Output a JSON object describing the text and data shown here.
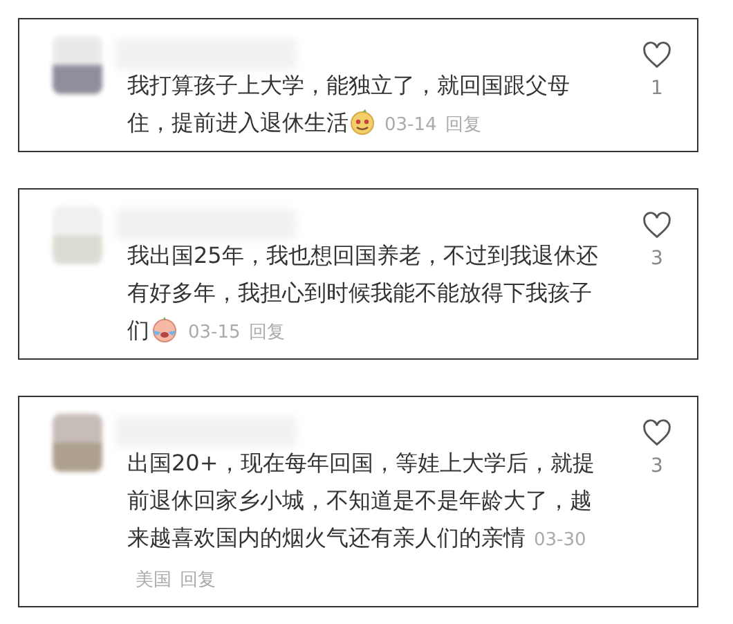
{
  "comments": [
    {
      "kind": "laugh",
      "text": "我打算孩子上大学，能独立了，就回国跟父母住，提前进入退休生活",
      "date": "03-14",
      "reply": "回复",
      "likes": "1"
    },
    {
      "kind": "cry",
      "text": "我出国25年，我也想回国养老，不过到我退休还有好多年，我担心到时候我能不能放得下我孩子们",
      "date": "03-15",
      "reply": "回复",
      "likes": "3"
    },
    {
      "kind": "plain",
      "text": "出国20+，现在每年回国，等娃上大学后，就提前退休回家乡小城，不知道是不是年龄大了，越来越喜欢国内的烟火气还有亲人们的亲情",
      "date": "03-30",
      "location": "美国",
      "reply": "回复",
      "likes": "3"
    }
  ]
}
